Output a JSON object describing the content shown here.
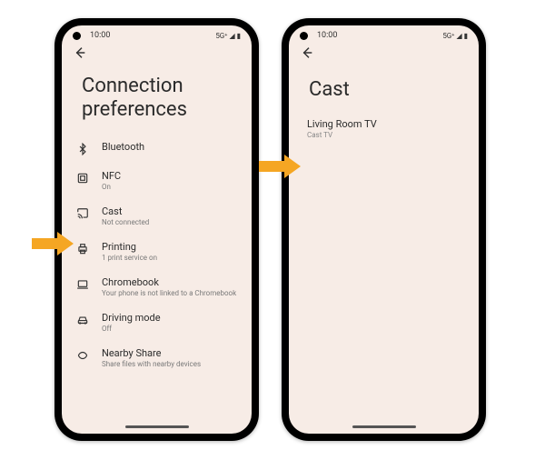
{
  "status": {
    "time": "10:00",
    "right": "5G⁺ ◢ ▮"
  },
  "left": {
    "title_line1": "Connection",
    "title_line2": "preferences",
    "items": [
      {
        "label": "Bluetooth",
        "sub": ""
      },
      {
        "label": "NFC",
        "sub": "On"
      },
      {
        "label": "Cast",
        "sub": "Not connected"
      },
      {
        "label": "Printing",
        "sub": "1 print service on"
      },
      {
        "label": "Chromebook",
        "sub": "Your phone is not linked to a Chromebook"
      },
      {
        "label": "Driving mode",
        "sub": "Off"
      },
      {
        "label": "Nearby Share",
        "sub": "Share files with nearby devices"
      }
    ]
  },
  "right": {
    "title": "Cast",
    "device": {
      "name": "Living Room TV",
      "sub": "Cast TV"
    }
  }
}
